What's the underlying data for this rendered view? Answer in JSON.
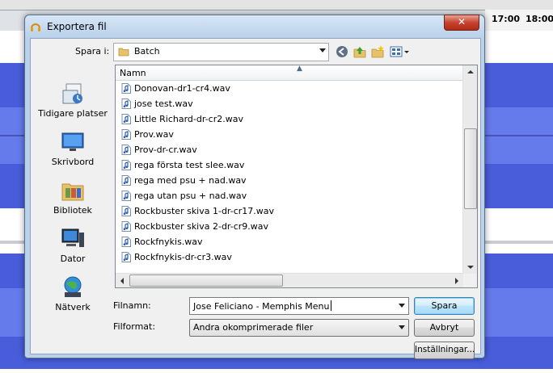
{
  "dialog": {
    "title": "Exportera fil",
    "close_symbol": "✕"
  },
  "background": {
    "ruler_ticks": [
      "17:00",
      "18:00"
    ]
  },
  "look_in": {
    "label": "Spara i:",
    "value": "Batch"
  },
  "toolbar": {
    "icons": [
      "back-icon",
      "up-folder-icon",
      "new-folder-icon",
      "view-menu-icon"
    ]
  },
  "places": [
    {
      "label": "Tidigare platser",
      "icon": "recent-places-icon"
    },
    {
      "label": "Skrivbord",
      "icon": "desktop-icon"
    },
    {
      "label": "Bibliotek",
      "icon": "libraries-icon"
    },
    {
      "label": "Dator",
      "icon": "computer-icon"
    },
    {
      "label": "Nätverk",
      "icon": "network-icon"
    }
  ],
  "file_list": {
    "column_name": "Namn",
    "files": [
      "Donovan-dr1-cr4.wav",
      "jose test.wav",
      "Little Richard-dr-cr2.wav",
      "Prov.wav",
      "Prov-dr-cr.wav",
      "rega första test slee.wav",
      "rega med psu + nad.wav",
      "rega utan psu + nad.wav",
      "Rockbuster skiva 1-dr-cr17.wav",
      "Rockbuster skiva 2-dr-cr9.wav",
      "Rockfnykis.wav",
      "Rockfnykis-dr-cr3.wav"
    ]
  },
  "filename": {
    "label": "Filnamn:",
    "value": "Jose Feliciano - Memphis Menu"
  },
  "format": {
    "label": "Filformat:",
    "value": "Andra okomprimerade filer"
  },
  "buttons": {
    "save": "Spara",
    "cancel": "Avbryt",
    "settings": "Inställningar..."
  },
  "colors": {
    "waveform": "#3a4fd8",
    "dialog_frame": "#b9d1ea",
    "accent": "#3c7fb1"
  }
}
